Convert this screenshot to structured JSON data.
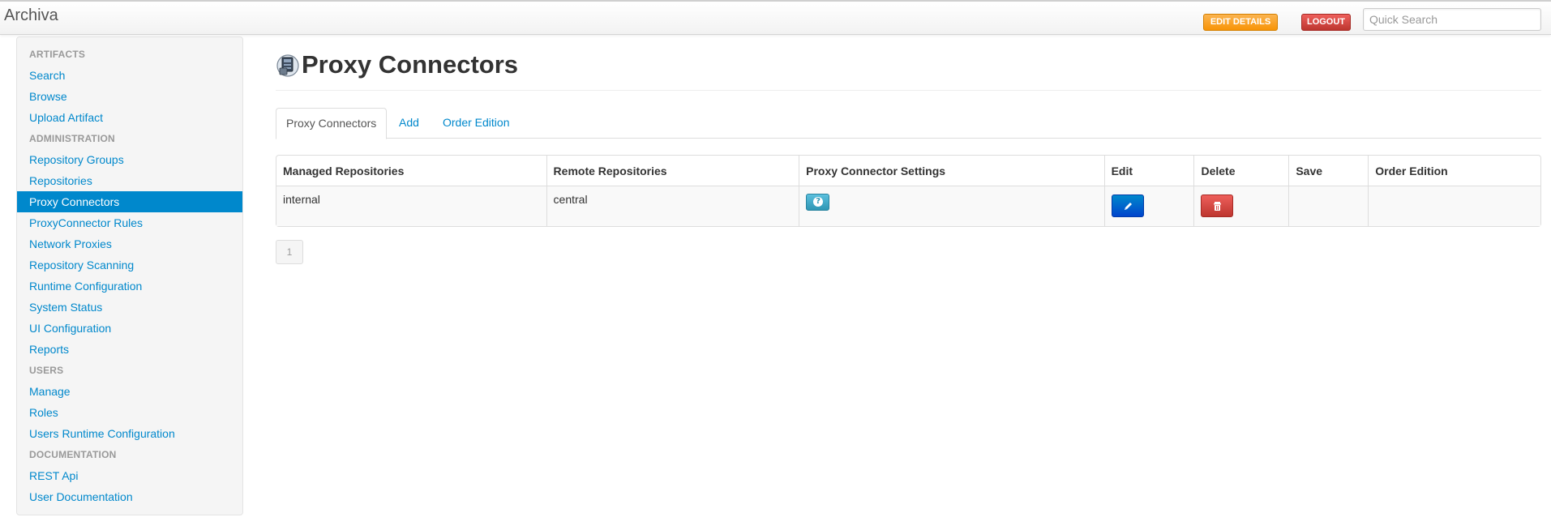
{
  "app": {
    "brand": "Archiva",
    "edit_details_label": "EDIT DETAILS",
    "logout_label": "LOGOUT",
    "quick_search_placeholder": "Quick Search"
  },
  "sidebar": {
    "sections": [
      {
        "header": "ARTIFACTS",
        "items": [
          "Search",
          "Browse",
          "Upload Artifact"
        ]
      },
      {
        "header": "ADMINISTRATION",
        "items": [
          "Repository Groups",
          "Repositories",
          "Proxy Connectors",
          "ProxyConnector Rules",
          "Network Proxies",
          "Repository Scanning",
          "Runtime Configuration",
          "System Status",
          "UI Configuration",
          "Reports"
        ]
      },
      {
        "header": "USERS",
        "items": [
          "Manage",
          "Roles",
          "Users Runtime Configuration"
        ]
      },
      {
        "header": "DOCUMENTATION",
        "items": [
          "REST Api",
          "User Documentation"
        ]
      }
    ],
    "active_item": "Proxy Connectors"
  },
  "main": {
    "title": "Proxy Connectors",
    "tabs": [
      {
        "label": "Proxy Connectors",
        "active": true
      },
      {
        "label": "Add",
        "active": false
      },
      {
        "label": "Order Edition",
        "active": false
      }
    ],
    "table": {
      "headers": [
        "Managed Repositories",
        "Remote Repositories",
        "Proxy Connector Settings",
        "Edit",
        "Delete",
        "Save",
        "Order Edition"
      ],
      "rows": [
        {
          "managed": "internal",
          "remote": "central"
        }
      ]
    },
    "pagination": {
      "current_page": "1"
    }
  },
  "colors": {
    "link": "#0088cc",
    "active_nav": "#0088cc",
    "edit_details": "#f89406",
    "logout": "#bd362f",
    "info_button": "#2f96b4",
    "edit_button": "#0044cc",
    "delete_button": "#bd362f"
  },
  "icons": {
    "title_icon": "proxy-connector-icon",
    "settings_icon": "question-icon",
    "edit_icon": "pencil-icon",
    "delete_icon": "trash-icon"
  }
}
